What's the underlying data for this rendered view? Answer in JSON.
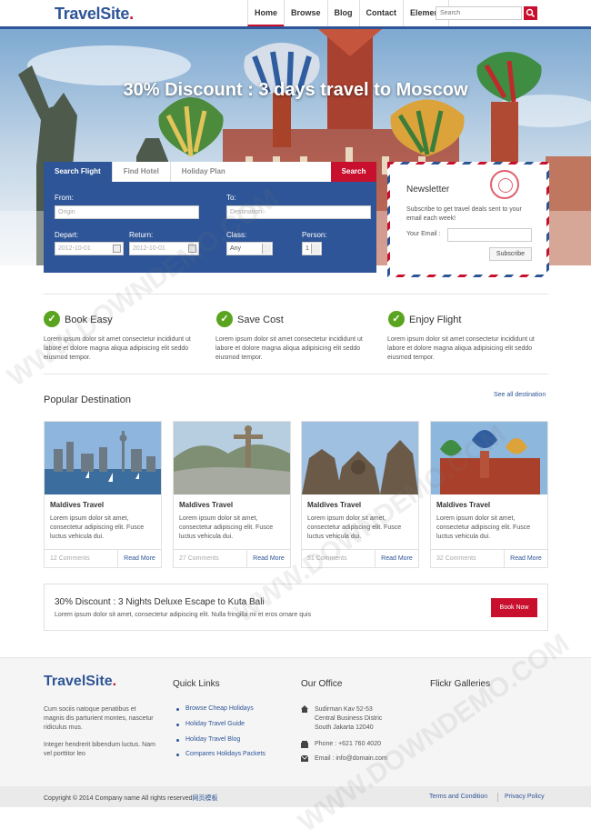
{
  "header": {
    "logo_main": "TravelSite",
    "logo_dot": ".",
    "nav": [
      "Home",
      "Browse",
      "Blog",
      "Contact",
      "Element"
    ],
    "search_placeholder": "Search"
  },
  "hero": {
    "title": "30% Discount : 3 days travel to Moscow"
  },
  "search_form": {
    "tabs": [
      "Search Flight",
      "Find Hotel",
      "Holiday Plan"
    ],
    "search_button": "Search",
    "from_label": "From:",
    "from_placeholder": "Origin",
    "to_label": "To:",
    "to_placeholder": "Destination",
    "depart_label": "Depart:",
    "depart_value": "2012-10-01",
    "return_label": "Return:",
    "return_value": "2012-10-01",
    "class_label": "Class:",
    "class_value": "Any",
    "person_label": "Person:",
    "person_value": "1"
  },
  "newsletter": {
    "title": "Newsletter",
    "text": "Subscribe to get travel deals sent to your email each week!",
    "email_label": "Your Email :",
    "button": "Subscribe"
  },
  "features": [
    {
      "title": "Book Easy",
      "text": "Lorem ipsum dolor sit amet consectetur incididunt ut labore et dolore magna aliqua adipisicing elit seddo eiusmod tempor."
    },
    {
      "title": "Save Cost",
      "text": "Lorem ipsum dolor sit amet consectetur incididunt ut labore et dolore magna aliqua adipisicing elit seddo eiusmod tempor."
    },
    {
      "title": "Enjoy Flight",
      "text": "Lorem ipsum dolor sit amet consectetur incididunt ut labore et dolore magna aliqua adipisicing elit seddo eiusmod tempor."
    }
  ],
  "popular": {
    "title": "Popular Destination",
    "see_all": "See all destination",
    "cards": [
      {
        "title": "Maldives Travel",
        "text": "Lorem ipsum dolor sit amet, consectetur adipiscing elit. Fusce luctus vehicula dui.",
        "comments": "12 Comments",
        "read_more": "Read More"
      },
      {
        "title": "Maldives Travel",
        "text": "Lorem ipsum dolor sit amet, consectetur adipiscing elit. Fusce luctus vehicula dui.",
        "comments": "27 Comments",
        "read_more": "Read More"
      },
      {
        "title": "Maldives Travel",
        "text": "Lorem ipsum dolor sit amet, consectetur adipiscing elit. Fusce luctus vehicula dui.",
        "comments": "51 Comments",
        "read_more": "Read More"
      },
      {
        "title": "Maldives Travel",
        "text": "Lorem ipsum dolor sit amet, consectetur adipiscing elit. Fusce luctus vehicula dui.",
        "comments": "32 Comments",
        "read_more": "Read More"
      }
    ]
  },
  "promo": {
    "title": "30% Discount : 3 Nights Deluxe Escape to Kuta Bali",
    "text": "Lorem ipsum dolor sit amet, consectetur adipiscing elit. Nulla fringilla mi et eros ornare quis",
    "button": "Book Now"
  },
  "footer": {
    "about_1": "Cum sociis natoque penatibus et magnis dis parturient montes, nascetur ridiculus mus.",
    "about_2": "Integer hendrerit bibendum luctus. Nam vel porttitor leo",
    "quick_links_title": "Quick Links",
    "quick_links": [
      "Browse Cheap Holidays",
      "Holiday Travel Guide",
      "Holiday Travel Blog",
      "Compares Holidays Packets"
    ],
    "office_title": "Our Office",
    "address": [
      "Sudirman Kav 52-53",
      "Central Business Distric",
      "South Jakarta 12040"
    ],
    "phone": "Phone : +621 760 4020",
    "email": "Email : info@domain.com",
    "flickr_title": "Flickr Galleries",
    "copyright": "Copyright © 2014 Company name All rights reserved",
    "copyright_cn": "网页模板",
    "terms": "Terms and Condition",
    "privacy": "Privacy Policy"
  },
  "watermark": "WWW.DOWNDEMO.COM",
  "colors": {
    "brand_blue": "#2e5597",
    "accent_red": "#c8102e",
    "check_green": "#5aa41f"
  }
}
